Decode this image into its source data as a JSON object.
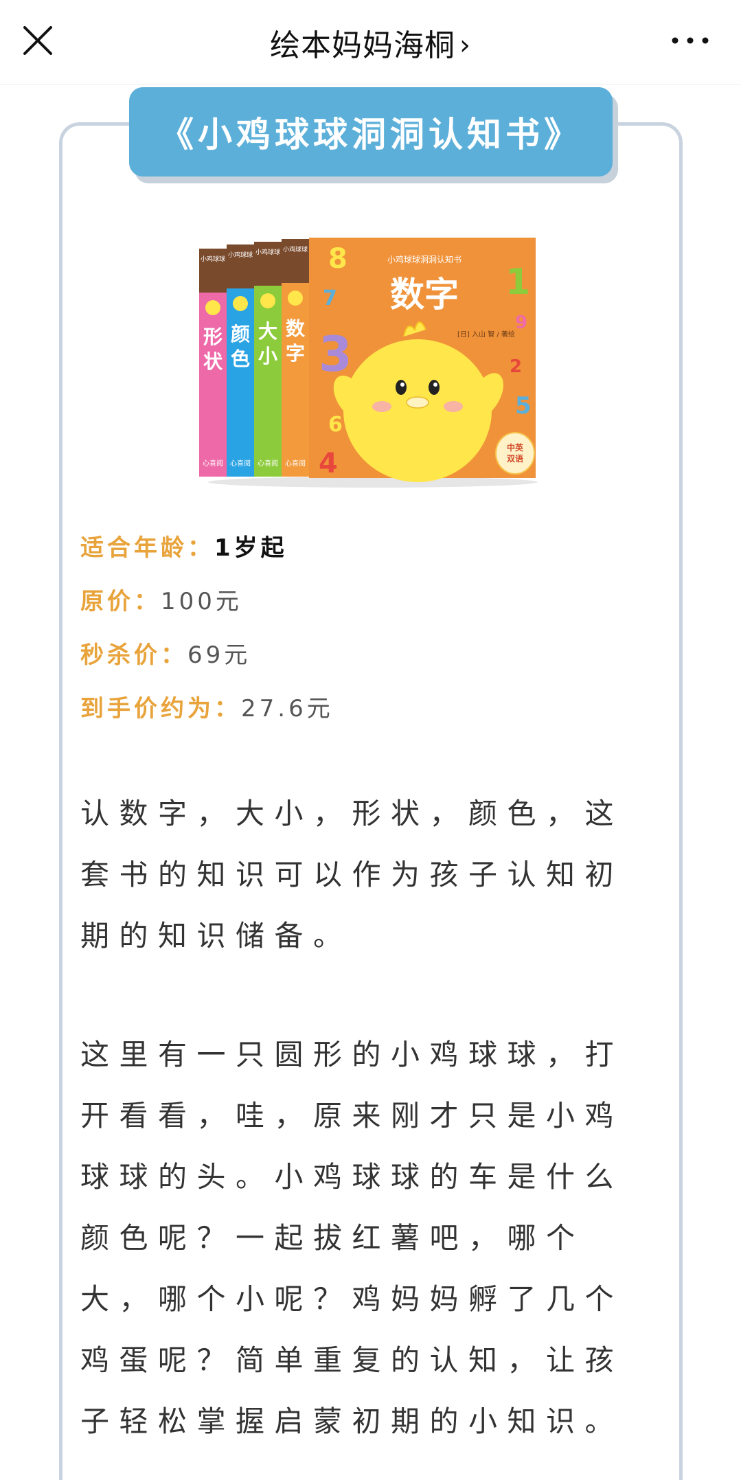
{
  "nav": {
    "title": "绘本妈妈海桐",
    "chevron": "›",
    "close_icon": "close-icon",
    "more_icon": "more-icon"
  },
  "banner": {
    "title": "《小鸡球球洞洞认知书》"
  },
  "book_cover": {
    "series_top": "小鸡球球洞洞认知书",
    "main_title": "数字",
    "spines": [
      "形状",
      "颜色",
      "大小",
      "数字"
    ],
    "spine_small": "小鸡球球",
    "publisher": "心喜阅",
    "author": "[日] 入山 智 / 著绘",
    "badge_line1": "中英",
    "badge_line2": "双语",
    "digits": [
      "8",
      "7",
      "3",
      "6",
      "4",
      "1",
      "9",
      "2",
      "5"
    ]
  },
  "info": {
    "age_label": "适合年龄：",
    "age_value": "1岁起",
    "orig_label": "原价：",
    "orig_value": "100元",
    "sale_label": "秒杀价：",
    "sale_value": "69元",
    "final_label": "到手价约为：",
    "final_value": "27.6元"
  },
  "paragraphs": {
    "p1": "认数字，大小，形状，颜色，这套书的知识可以作为孩子认知初期的知识储备。",
    "p2": "这里有一只圆形的小鸡球球，打开看看，哇，原来刚才只是小鸡球球的头。小鸡球球的车是什么颜色呢？一起拔红薯吧，哪个大，哪个小呢？鸡妈妈孵了几个鸡蛋呢？简单重复的认知，让孩子轻松掌握启蒙初期的小知识。"
  },
  "colors": {
    "banner": "#5bafd9",
    "label_orange": "#e8a33b",
    "cover_orange": "#f0923a",
    "spine_pink": "#ee69a8",
    "spine_blue": "#2aa3e4",
    "spine_green": "#8ccc3c",
    "spine_orange": "#f39a3c",
    "chick_yellow": "#ffe64a"
  }
}
